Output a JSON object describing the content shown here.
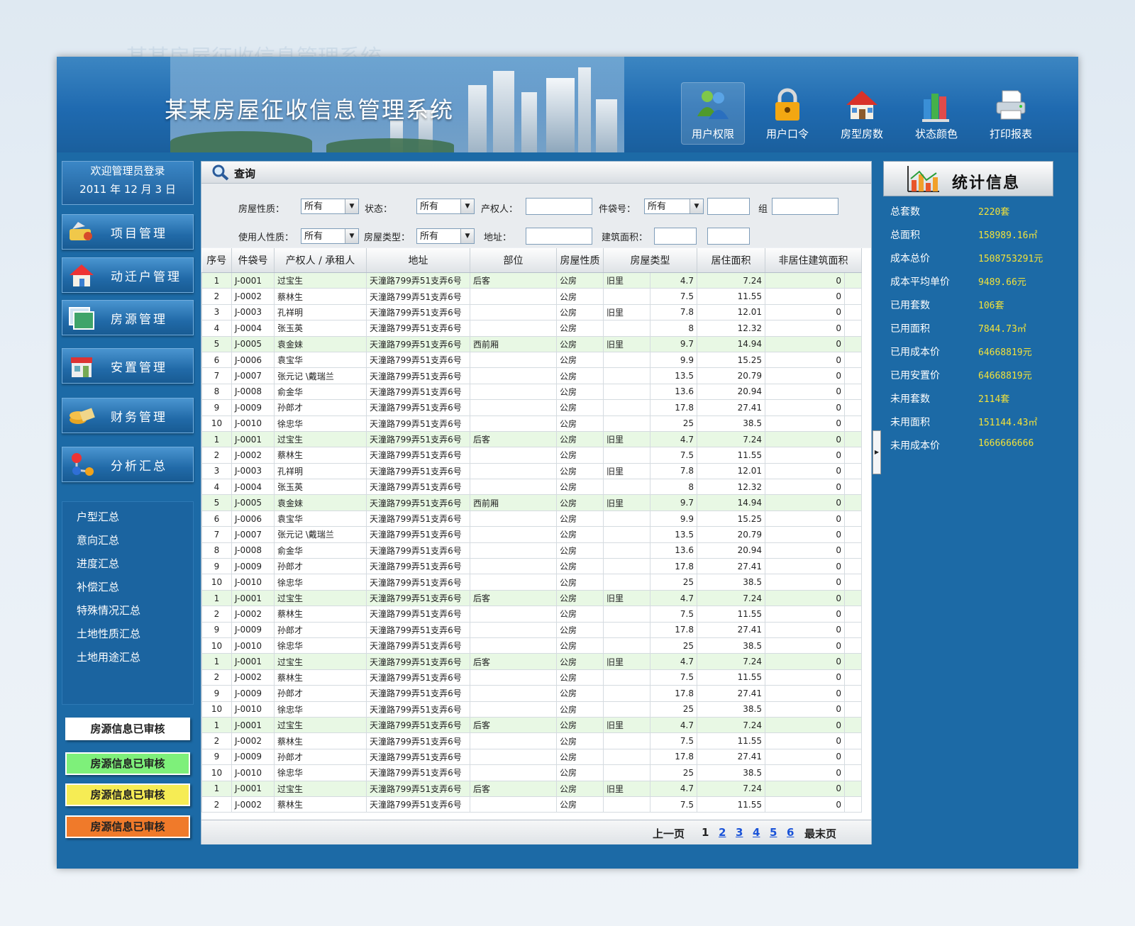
{
  "app": {
    "title": "某某房屋征收信息管理系统"
  },
  "toolbar": [
    {
      "label": "用户权限",
      "icon": "users-icon"
    },
    {
      "label": "用户口令",
      "icon": "lock-icon"
    },
    {
      "label": "房型房数",
      "icon": "house-icon"
    },
    {
      "label": "状态颜色",
      "icon": "books-icon"
    },
    {
      "label": "打印报表",
      "icon": "printer-icon"
    }
  ],
  "welcome": {
    "line1": "欢迎管理员登录",
    "line2": "2011 年 12 月 3 日"
  },
  "nav": [
    {
      "label": "项目管理",
      "icon": "project-icon"
    },
    {
      "label": "动迁户管理",
      "icon": "home-icon"
    },
    {
      "label": "房源管理",
      "icon": "photo-icon"
    },
    {
      "label": "安置管理",
      "icon": "shop-icon"
    },
    {
      "label": "财务管理",
      "icon": "coins-icon"
    },
    {
      "label": "分析汇总",
      "icon": "molecule-icon"
    }
  ],
  "subnav": [
    "户型汇总",
    "意向汇总",
    "进度汇总",
    "补偿汇总",
    "特殊情况汇总",
    "土地性质汇总",
    "土地用途汇总"
  ],
  "audit_buttons": [
    {
      "label": "房源信息已审核",
      "color": "#ffffff"
    },
    {
      "label": "房源信息已审核",
      "color": "#7ef07a"
    },
    {
      "label": "房源信息已审核",
      "color": "#f6ec54"
    },
    {
      "label": "房源信息已审核",
      "color": "#f07a2a"
    }
  ],
  "query": {
    "title": "查询",
    "house_nature": {
      "label": "房屋性质：",
      "value": "所有"
    },
    "status": {
      "label": "状态：",
      "value": "所有"
    },
    "owner": {
      "label": "产权人：",
      "value": ""
    },
    "bag_no": {
      "label": "件袋号：",
      "value": "所有"
    },
    "group": {
      "label": "组"
    },
    "user_nature": {
      "label": "使用人性质：",
      "value": "所有"
    },
    "house_type": {
      "label": "房屋类型：",
      "value": "所有"
    },
    "address": {
      "label": "地址：",
      "value": ""
    },
    "build_area": {
      "label": "建筑面积：",
      "value": ""
    }
  },
  "table": {
    "headers": [
      "序号",
      "件袋号",
      "产权人 / 承租人",
      "地址",
      "部位",
      "房屋性质",
      "房屋类型",
      "居住面积",
      "非居住建筑面积"
    ],
    "rows": [
      [
        "1",
        "J-0001",
        "过宝生",
        "天潼路799弄51支弄6号",
        "后客",
        "公房",
        "旧里",
        "4.7",
        "7.24",
        "0"
      ],
      [
        "2",
        "J-0002",
        "蔡林生",
        "天潼路799弄51支弄6号",
        "",
        "公房",
        "",
        "7.5",
        "11.55",
        "0"
      ],
      [
        "3",
        "J-0003",
        "孔祥明",
        "天潼路799弄51支弄6号",
        "",
        "公房",
        "旧里",
        "7.8",
        "12.01",
        "0"
      ],
      [
        "4",
        "J-0004",
        "张玉英",
        "天潼路799弄51支弄6号",
        "",
        "公房",
        "",
        "8",
        "12.32",
        "0"
      ],
      [
        "5",
        "J-0005",
        "袁金妹",
        "天潼路799弄51支弄6号",
        "西前厢",
        "公房",
        "旧里",
        "9.7",
        "14.94",
        "0"
      ],
      [
        "6",
        "J-0006",
        "袁宝华",
        "天潼路799弄51支弄6号",
        "",
        "公房",
        "",
        "9.9",
        "15.25",
        "0"
      ],
      [
        "7",
        "J-0007",
        "张元记 \\戴瑞兰",
        "天潼路799弄51支弄6号",
        "",
        "公房",
        "",
        "13.5",
        "20.79",
        "0"
      ],
      [
        "8",
        "J-0008",
        "俞金华",
        "天潼路799弄51支弄6号",
        "",
        "公房",
        "",
        "13.6",
        "20.94",
        "0"
      ],
      [
        "9",
        "J-0009",
        "孙郎才",
        "天潼路799弄51支弄6号",
        "",
        "公房",
        "",
        "17.8",
        "27.41",
        "0"
      ],
      [
        "10",
        "J-0010",
        "徐忠华",
        "天潼路799弄51支弄6号",
        "",
        "公房",
        "",
        "25",
        "38.5",
        "0"
      ],
      [
        "1",
        "J-0001",
        "过宝生",
        "天潼路799弄51支弄6号",
        "后客",
        "公房",
        "旧里",
        "4.7",
        "7.24",
        "0"
      ],
      [
        "2",
        "J-0002",
        "蔡林生",
        "天潼路799弄51支弄6号",
        "",
        "公房",
        "",
        "7.5",
        "11.55",
        "0"
      ],
      [
        "3",
        "J-0003",
        "孔祥明",
        "天潼路799弄51支弄6号",
        "",
        "公房",
        "旧里",
        "7.8",
        "12.01",
        "0"
      ],
      [
        "4",
        "J-0004",
        "张玉英",
        "天潼路799弄51支弄6号",
        "",
        "公房",
        "",
        "8",
        "12.32",
        "0"
      ],
      [
        "5",
        "J-0005",
        "袁金妹",
        "天潼路799弄51支弄6号",
        "西前厢",
        "公房",
        "旧里",
        "9.7",
        "14.94",
        "0"
      ],
      [
        "6",
        "J-0006",
        "袁宝华",
        "天潼路799弄51支弄6号",
        "",
        "公房",
        "",
        "9.9",
        "15.25",
        "0"
      ],
      [
        "7",
        "J-0007",
        "张元记 \\戴瑞兰",
        "天潼路799弄51支弄6号",
        "",
        "公房",
        "",
        "13.5",
        "20.79",
        "0"
      ],
      [
        "8",
        "J-0008",
        "俞金华",
        "天潼路799弄51支弄6号",
        "",
        "公房",
        "",
        "13.6",
        "20.94",
        "0"
      ],
      [
        "9",
        "J-0009",
        "孙郎才",
        "天潼路799弄51支弄6号",
        "",
        "公房",
        "",
        "17.8",
        "27.41",
        "0"
      ],
      [
        "10",
        "J-0010",
        "徐忠华",
        "天潼路799弄51支弄6号",
        "",
        "公房",
        "",
        "25",
        "38.5",
        "0"
      ],
      [
        "1",
        "J-0001",
        "过宝生",
        "天潼路799弄51支弄6号",
        "后客",
        "公房",
        "旧里",
        "4.7",
        "7.24",
        "0"
      ],
      [
        "2",
        "J-0002",
        "蔡林生",
        "天潼路799弄51支弄6号",
        "",
        "公房",
        "",
        "7.5",
        "11.55",
        "0"
      ],
      [
        "9",
        "J-0009",
        "孙郎才",
        "天潼路799弄51支弄6号",
        "",
        "公房",
        "",
        "17.8",
        "27.41",
        "0"
      ],
      [
        "10",
        "J-0010",
        "徐忠华",
        "天潼路799弄51支弄6号",
        "",
        "公房",
        "",
        "25",
        "38.5",
        "0"
      ],
      [
        "1",
        "J-0001",
        "过宝生",
        "天潼路799弄51支弄6号",
        "后客",
        "公房",
        "旧里",
        "4.7",
        "7.24",
        "0"
      ],
      [
        "2",
        "J-0002",
        "蔡林生",
        "天潼路799弄51支弄6号",
        "",
        "公房",
        "",
        "7.5",
        "11.55",
        "0"
      ],
      [
        "9",
        "J-0009",
        "孙郎才",
        "天潼路799弄51支弄6号",
        "",
        "公房",
        "",
        "17.8",
        "27.41",
        "0"
      ],
      [
        "10",
        "J-0010",
        "徐忠华",
        "天潼路799弄51支弄6号",
        "",
        "公房",
        "",
        "25",
        "38.5",
        "0"
      ],
      [
        "1",
        "J-0001",
        "过宝生",
        "天潼路799弄51支弄6号",
        "后客",
        "公房",
        "旧里",
        "4.7",
        "7.24",
        "0"
      ],
      [
        "2",
        "J-0002",
        "蔡林生",
        "天潼路799弄51支弄6号",
        "",
        "公房",
        "",
        "7.5",
        "11.55",
        "0"
      ],
      [
        "9",
        "J-0009",
        "孙郎才",
        "天潼路799弄51支弄6号",
        "",
        "公房",
        "",
        "17.8",
        "27.41",
        "0"
      ],
      [
        "10",
        "J-0010",
        "徐忠华",
        "天潼路799弄51支弄6号",
        "",
        "公房",
        "",
        "25",
        "38.5",
        "0"
      ],
      [
        "1",
        "J-0001",
        "过宝生",
        "天潼路799弄51支弄6号",
        "后客",
        "公房",
        "旧里",
        "4.7",
        "7.24",
        "0"
      ],
      [
        "2",
        "J-0002",
        "蔡林生",
        "天潼路799弄51支弄6号",
        "",
        "公房",
        "",
        "7.5",
        "11.55",
        "0"
      ]
    ]
  },
  "pager": {
    "prev": "上一页",
    "pages": [
      "1",
      "2",
      "3",
      "4",
      "5",
      "6"
    ],
    "current": "1",
    "last": "最末页"
  },
  "stats": {
    "title": "统计信息",
    "items": [
      {
        "label": "总套数",
        "value": "2220套"
      },
      {
        "label": "总面积",
        "value": "158989.16㎡"
      },
      {
        "label": "成本总价",
        "value": "1508753291元"
      },
      {
        "label": "成本平均单价",
        "value": "9489.66元"
      },
      {
        "label": "已用套数",
        "value": "106套"
      },
      {
        "label": "已用面积",
        "value": "7844.73㎡"
      },
      {
        "label": "已用成本价",
        "value": "64668819元"
      },
      {
        "label": "已用安置价",
        "value": "64668819元"
      },
      {
        "label": "未用套数",
        "value": "2114套"
      },
      {
        "label": "未用面积",
        "value": "151144.43㎡"
      },
      {
        "label": "未用成本价",
        "value": "1666666666"
      }
    ]
  }
}
